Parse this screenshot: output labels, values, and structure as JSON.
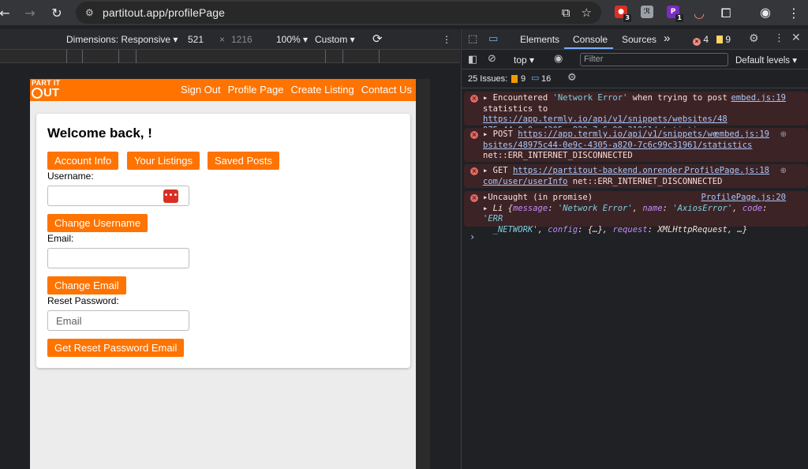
{
  "browser": {
    "url": "partitout.app/profilePage",
    "extensions": [
      {
        "name": "ext-1",
        "color": "#d93025",
        "badge": "3"
      },
      {
        "name": "ext-2",
        "color": "#e8eaed",
        "badge": ""
      },
      {
        "name": "ext-3",
        "color": "#7b2cbf",
        "badge": "1"
      }
    ]
  },
  "device_toolbar": {
    "dimensions_label": "Dimensions: Responsive",
    "width": "521",
    "times": "×",
    "height": "1216",
    "zoom": "100%",
    "throttle": "Custom"
  },
  "site": {
    "logo_line1": "PART IT",
    "logo_line2": "UT",
    "nav": [
      "Sign Out",
      "Profile Page",
      "Create Listing",
      "Contact Us"
    ],
    "welcome": "Welcome back, !",
    "tabs": [
      "Account Info",
      "Your Listings",
      "Saved Posts"
    ],
    "username_label": "Username:",
    "change_username": "Change Username",
    "email_label": "Email:",
    "change_email": "Change Email",
    "reset_label": "Reset Password:",
    "reset_placeholder": "Email",
    "reset_button": "Get Reset Password Email",
    "password_manager_glyph": "•••"
  },
  "devtools": {
    "tabs": [
      "Elements",
      "Console",
      "Sources"
    ],
    "active_tab": "Console",
    "more": "»",
    "error_count": "4",
    "warning_count": "9",
    "context": "top",
    "filter_placeholder": "Filter",
    "levels": "Default levels",
    "issues_label": "25 Issues:",
    "issues_warn": "9",
    "issues_info": "16",
    "messages": [
      {
        "source": "embed.js:19",
        "line1_prefix": "Encountered ",
        "line1_str": "'Network Error'",
        "line1_suffix": " when trying to post",
        "line2_prefix": "statistics to ",
        "line2_link": "https://app.termly.io/api/v1/snippets/websites/48",
        "line3_link": "975c44-0e9c-4305-a820-7c6c99c31961/statistics"
      },
      {
        "source": "embed.js:19",
        "line1_prefix": "POST ",
        "line1_link": "https://app.termly.io/api/v1/snippets/we",
        "line2_link": "bsites/48975c44-0e9c-4305-a820-7c6c99c31961/statistics",
        "line3": "net::ERR_INTERNET_DISCONNECTED"
      },
      {
        "source": "ProfilePage.js:18",
        "line1_prefix": "GET ",
        "line1_link": "https://partitout-backend.onrender.",
        "line2_link": "com/user/userInfo",
        "line2_suffix": " net::ERR_INTERNET_DISCONNECTED"
      },
      {
        "source": "ProfilePage.js:20",
        "line1": "Uncaught (in promise)",
        "line2_prefix": "Li {",
        "k1": "message",
        "v1": "'Network Error'",
        "k2": "name",
        "v2": "'AxiosError'",
        "k3": "code",
        "v3": "'ERR",
        "line3_val": "_NETWORK'",
        "k4": "config",
        "v4": "{…}",
        "k5": "request",
        "v5": "XMLHttpRequest, …}"
      }
    ],
    "prompt": "›"
  }
}
